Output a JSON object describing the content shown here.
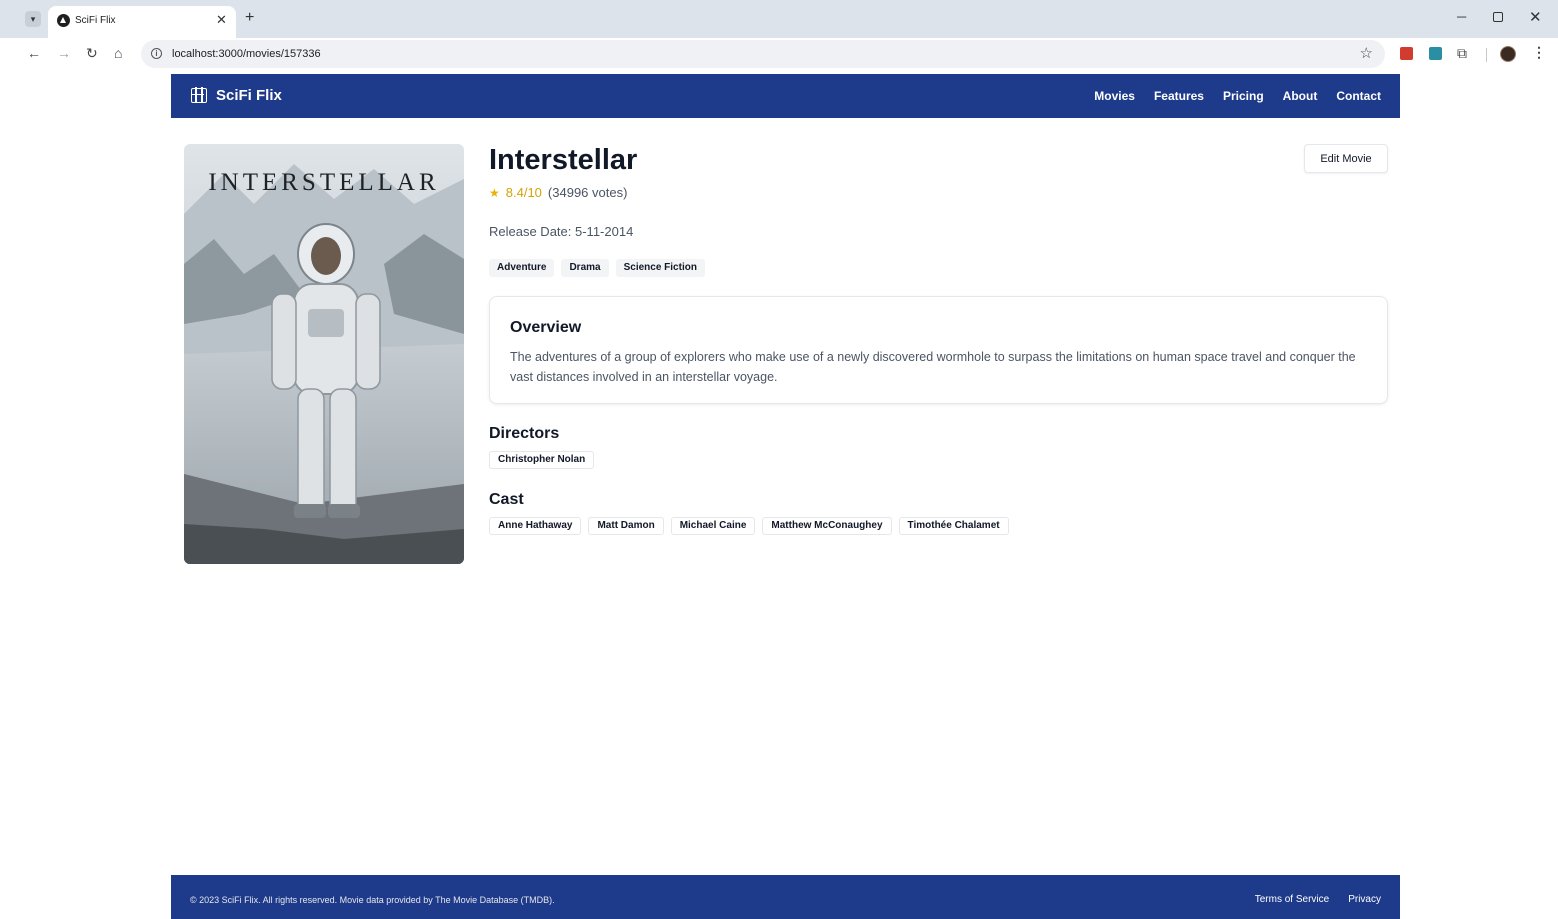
{
  "browser": {
    "tab_title": "SciFi Flix",
    "url": "localhost:3000/movies/157336"
  },
  "header": {
    "brand": "SciFi Flix",
    "nav": [
      "Movies",
      "Features",
      "Pricing",
      "About",
      "Contact"
    ]
  },
  "movie": {
    "title": "Interstellar",
    "poster_text": "INTERSTELLAR",
    "rating": "8.4/10",
    "votes": "(34996 votes)",
    "release": "Release Date: 5-11-2014",
    "edit_label": "Edit Movie",
    "genres": [
      "Adventure",
      "Drama",
      "Science Fiction"
    ],
    "overview_heading": "Overview",
    "overview": "The adventures of a group of explorers who make use of a newly discovered wormhole to surpass the limitations on human space travel and conquer the vast distances involved in an interstellar voyage.",
    "directors_heading": "Directors",
    "directors": [
      "Christopher Nolan"
    ],
    "cast_heading": "Cast",
    "cast": [
      "Anne Hathaway",
      "Matt Damon",
      "Michael Caine",
      "Matthew McConaughey",
      "Timothée Chalamet"
    ]
  },
  "footer": {
    "copyright": "© 2023 SciFi Flix. All rights reserved. Movie data provided by The Movie Database (TMDB).",
    "links": [
      "Terms of Service",
      "Privacy"
    ]
  },
  "colors": {
    "header_bg": "#1e3a8a",
    "star": "#eab308"
  }
}
